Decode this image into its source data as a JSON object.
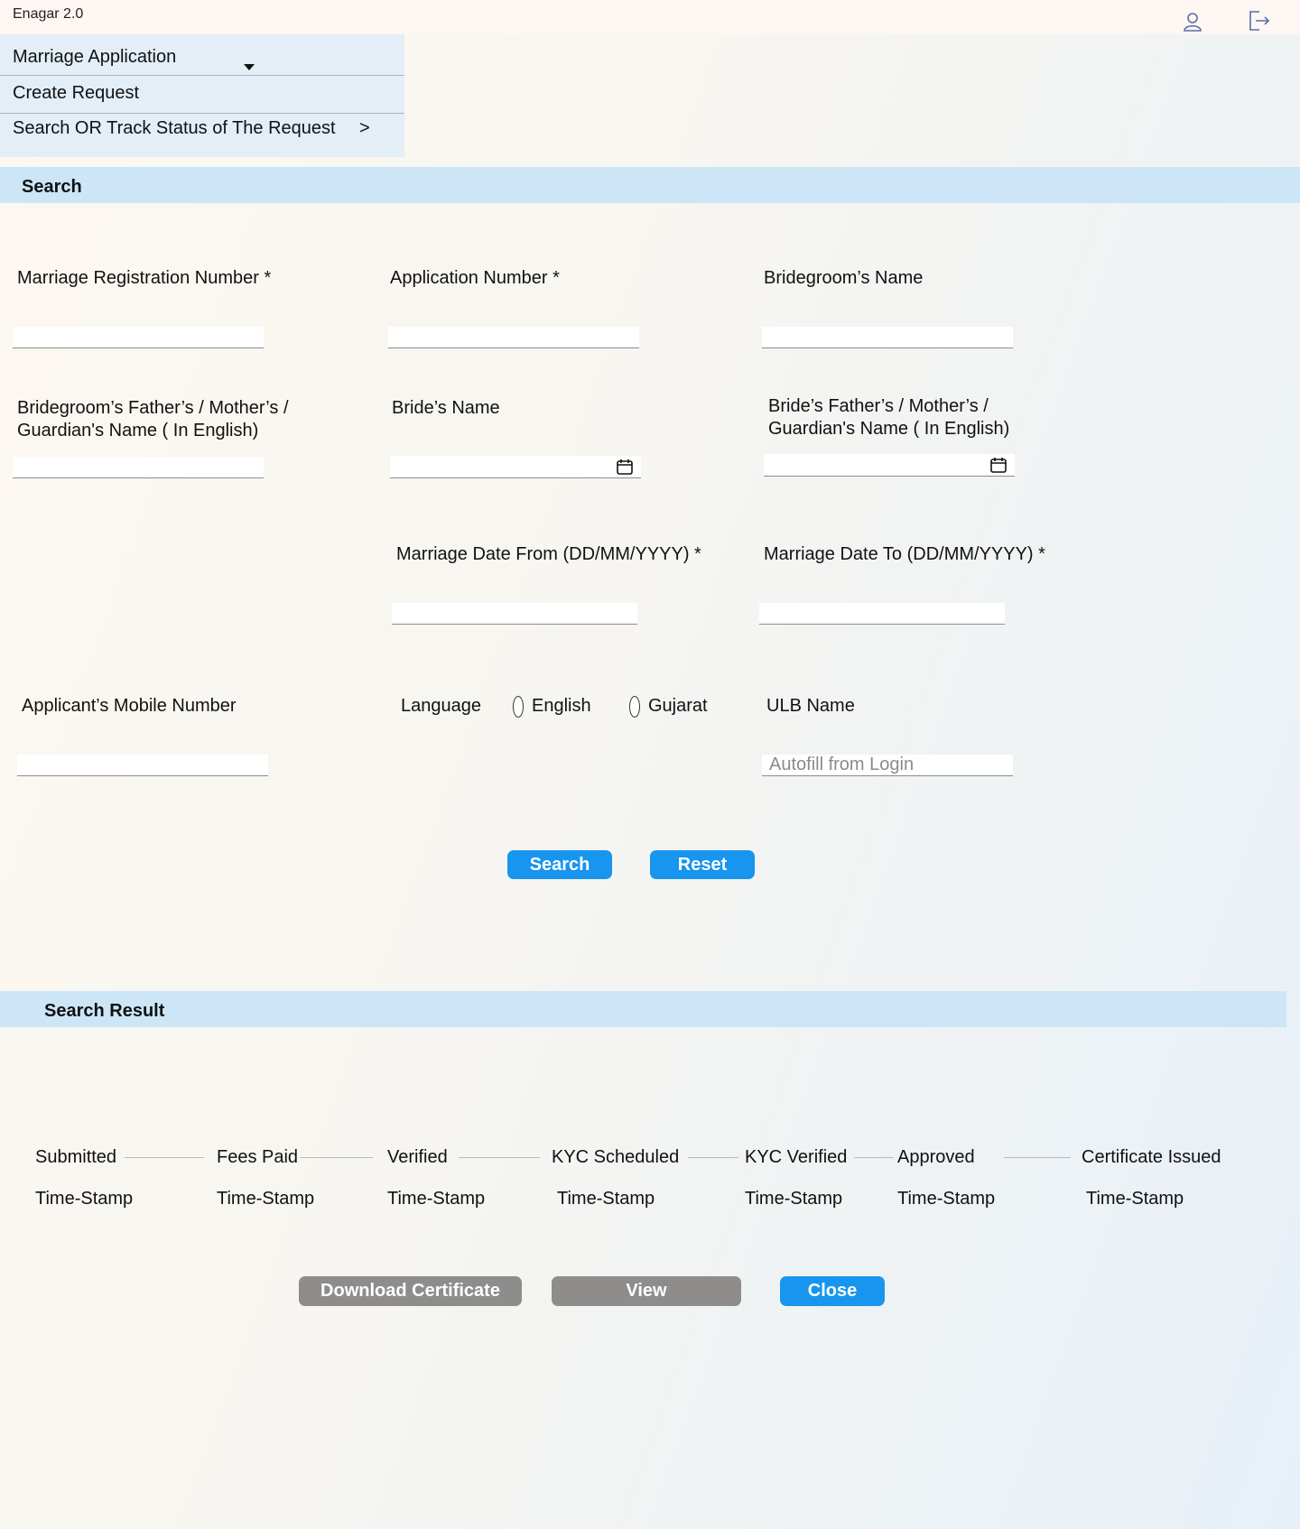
{
  "app": {
    "title": "Enagar 2.0"
  },
  "header_icons": {
    "user": "user-icon",
    "logout": "logout-icon"
  },
  "menu": {
    "dropdown_label": "Marriage Application",
    "create_request": "Create Request",
    "search_track": "Search OR Track Status of The Request",
    "search_track_arrow": ">"
  },
  "search_section": {
    "title": "Search",
    "fields": {
      "marriage_reg_no": "Marriage Registration Number *",
      "application_no": "Application Number *",
      "bridegroom_name": "Bridegroom’s Name",
      "bridegroom_parent_line1": "Bridegroom’s Father’s / Mother’s /",
      "bridegroom_parent_line2": "Guardian's  Name ( In English)",
      "bride_name": "Bride’s Name",
      "bride_parent_line1": "Bride’s Father’s / Mother’s /",
      "bride_parent_line2": "Guardian's  Name ( In English)",
      "date_from": "Marriage Date From (DD/MM/YYYY) *",
      "date_to": "Marriage Date To (DD/MM/YYYY) *",
      "mobile": "Applicant’s Mobile Number",
      "language": "Language",
      "lang_english": "English",
      "lang_gujarati": "Gujarat",
      "ulb": "ULB Name",
      "ulb_placeholder": "Autofill from Login"
    },
    "buttons": {
      "search": "Search",
      "reset": "Reset"
    }
  },
  "result_section": {
    "title": "Search Result",
    "steps": [
      {
        "label": "Submitted",
        "ts": "Time-Stamp"
      },
      {
        "label": "Fees Paid",
        "ts": "Time-Stamp"
      },
      {
        "label": "Verified",
        "ts": "Time-Stamp"
      },
      {
        "label": "KYC Scheduled",
        "ts": "Time-Stamp"
      },
      {
        "label": "KYC Verified",
        "ts": "Time-Stamp"
      },
      {
        "label": "Approved",
        "ts": "Time-Stamp"
      },
      {
        "label": "Certificate Issued",
        "ts": "Time-Stamp"
      }
    ],
    "buttons": {
      "download": "Download Certificate",
      "view": "View",
      "close": "Close"
    }
  },
  "colors": {
    "primary": "#1795ef",
    "secondary": "#8f8c8c",
    "section_bar": "#cce6f8",
    "menu_bg": "#e3eef7"
  }
}
